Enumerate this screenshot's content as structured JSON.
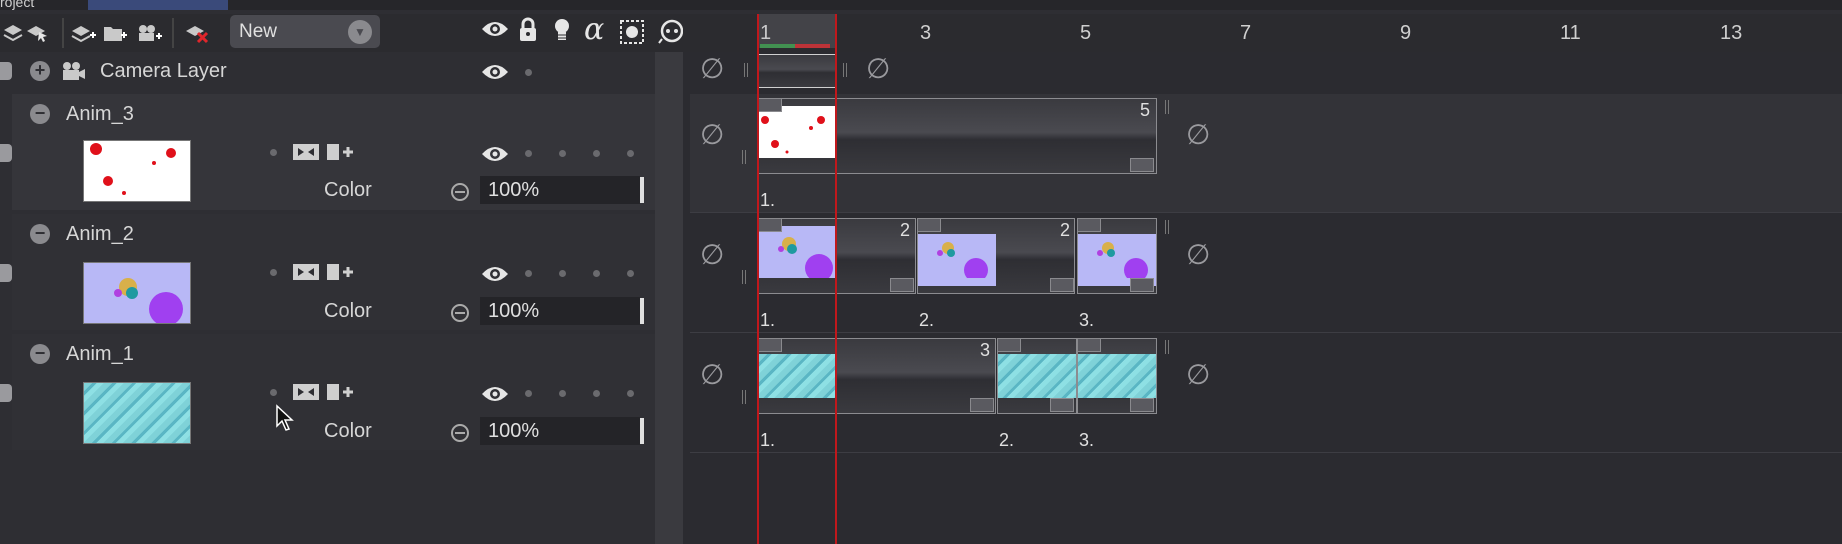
{
  "window": {
    "tab_text": "roject",
    "colors": {
      "bg": "#2e2e33",
      "playhead": "#c0181c",
      "selected_tab": "#3a4a7a"
    }
  },
  "toolbar": {
    "icons": [
      "layers-icon",
      "pointer-layers-icon",
      "add-layer-icon",
      "add-folder-icon",
      "add-camera-icon",
      "delete-layer-icon"
    ],
    "dropdown_value": "New",
    "right_icons": [
      "eye-icon",
      "lock-icon",
      "light-bulb-icon",
      "alpha-icon",
      "mask-icon",
      "onion-skin-icon"
    ],
    "alpha_glyph": "α"
  },
  "ruler": {
    "ticks": [
      "1",
      "3",
      "5",
      "7",
      "9",
      "11",
      "13"
    ]
  },
  "camera_layer": {
    "name": "Camera Layer"
  },
  "layers": [
    {
      "name": "Anim_3",
      "param": "Color",
      "opacity": "100%",
      "thumb": "red-dots"
    },
    {
      "name": "Anim_2",
      "param": "Color",
      "opacity": "100%",
      "thumb": "purple-circles"
    },
    {
      "name": "Anim_1",
      "param": "Color",
      "opacity": "100%",
      "thumb": "teal-texture"
    }
  ],
  "timeline": {
    "anim3": {
      "clip_count": "5",
      "seq": [
        "1."
      ]
    },
    "anim2": {
      "clip_counts": [
        "2",
        "2"
      ],
      "seq": [
        "1.",
        "2.",
        "3."
      ]
    },
    "anim1": {
      "clip_counts": [
        "3"
      ],
      "seq": [
        "1.",
        "2.",
        "3."
      ]
    },
    "null_symbol": "∅"
  }
}
